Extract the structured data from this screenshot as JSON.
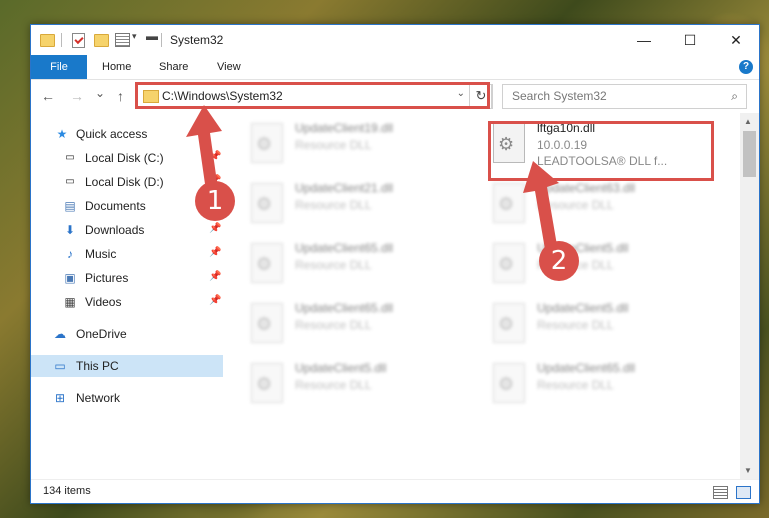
{
  "window": {
    "title": "System32",
    "controls": {
      "minimize": "—",
      "maximize": "☐",
      "close": "✕"
    }
  },
  "ribbon": {
    "tabs": [
      "File",
      "Home",
      "Share",
      "View"
    ],
    "help": "?"
  },
  "navbar": {
    "back": "←",
    "forward": "→",
    "recent": "⌄",
    "up": "↑",
    "address": "C:\\Windows\\System32",
    "address_dropdown": "⌄",
    "refresh": "↻",
    "search_placeholder": "Search System32",
    "search_icon": "search-icon"
  },
  "sidebar": {
    "items": [
      {
        "label": "Quick access",
        "icon": "star-icon"
      },
      {
        "label": "Local Disk (C:)",
        "icon": "drive-icon"
      },
      {
        "label": "Local Disk (D:)",
        "icon": "drive-icon"
      },
      {
        "label": "Documents",
        "icon": "document-icon"
      },
      {
        "label": "Downloads",
        "icon": "download-icon"
      },
      {
        "label": "Music",
        "icon": "music-icon"
      },
      {
        "label": "Pictures",
        "icon": "picture-icon"
      },
      {
        "label": "Videos",
        "icon": "video-icon"
      },
      {
        "label": "OneDrive",
        "icon": "cloud-icon"
      },
      {
        "label": "This PC",
        "icon": "computer-icon",
        "selected": true
      },
      {
        "label": "Network",
        "icon": "network-icon"
      }
    ]
  },
  "files": {
    "left": [
      {
        "name": "UpdateClient19.dll",
        "type": "Resource DLL"
      },
      {
        "name": "UpdateClient21.dll",
        "type": "Resource DLL"
      },
      {
        "name": "UpdateClient65.dll",
        "type": "Resource DLL"
      },
      {
        "name": "UpdateClient65.dll",
        "type": "Resource DLL"
      },
      {
        "name": "UpdateClient5.dll",
        "type": "Resource DLL"
      }
    ],
    "right": [
      {
        "name": "lftga10n.dll",
        "type": "10.0.0.19",
        "desc": "LEADTOOLSA® DLL f..."
      },
      {
        "name": "UpdateClient63.dll",
        "type": "Resource DLL"
      },
      {
        "name": "UpdateClient5.dll",
        "type": "Resource DLL"
      },
      {
        "name": "UpdateClient5.dll",
        "type": "Resource DLL"
      },
      {
        "name": "UpdateClient65.dll",
        "type": "Resource DLL"
      }
    ]
  },
  "annotations": {
    "step1": "1",
    "step2": "2",
    "color": "#d9504a"
  },
  "status": {
    "count": "134 items"
  }
}
